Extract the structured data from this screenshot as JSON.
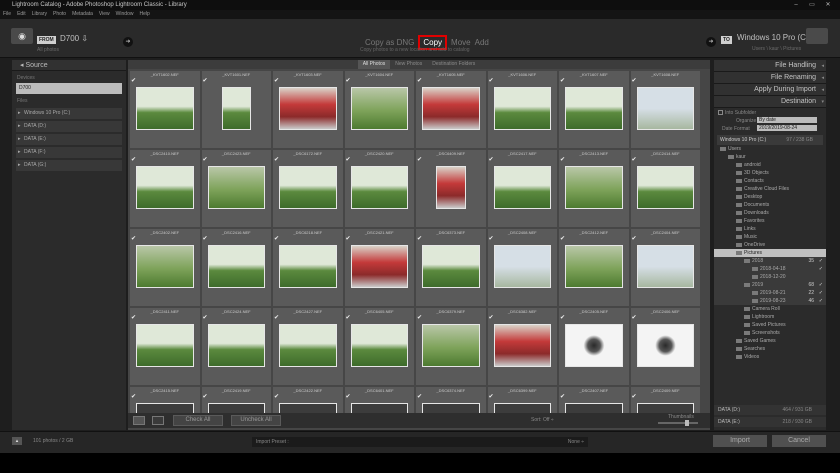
{
  "window": {
    "title": "Lightroom Catalog - Adobe Photoshop Lightroom Classic - Library",
    "controls": [
      "–",
      "▭",
      "✕"
    ]
  },
  "menu": [
    "File",
    "Edit",
    "Library",
    "Photo",
    "Metadata",
    "View",
    "Window",
    "Help"
  ],
  "header": {
    "from_tag": "FROM",
    "source_name": "D700 ⇩",
    "source_sub": "All photos",
    "modes": [
      "Copy as DNG",
      "Copy",
      "Move",
      "Add"
    ],
    "mode_active": "Copy",
    "mode_sub": "Copy photos to a new location and add to catalog",
    "to_tag": "TO",
    "dest_name": "Windows 10 Pro (C:) ⇩",
    "dest_sub": "Users \\ kaur \\ Pictures"
  },
  "source": {
    "title": "◂ Source",
    "devices_label": "Devices",
    "device": "D700",
    "files_label": "Files",
    "drives": [
      "Windows 10 Pro (C:)",
      "DATA (D:)",
      "DATA (E:)",
      "DATA (F:)",
      "DATA (G:)"
    ]
  },
  "tabs": [
    "All Photos",
    "New Photos",
    "Destination Folders"
  ],
  "tab_active": "All Photos",
  "photos": [
    {
      "name": "_KVT1602.NEF",
      "style": "g1"
    },
    {
      "name": "_KVT1601.NEF",
      "style": "g1 portrait"
    },
    {
      "name": "_KVT1603.NEF",
      "style": "red"
    },
    {
      "name": "_KVT1604.NEF",
      "style": "g2"
    },
    {
      "name": "_KVT1605.NEF",
      "style": "red"
    },
    {
      "name": "_KVT1606.NEF",
      "style": "g1"
    },
    {
      "name": "_KVT1607.NEF",
      "style": "g1"
    },
    {
      "name": "_KVT1608.NEF",
      "style": "g3"
    },
    {
      "name": "_DSC2410.NEF",
      "style": "g1"
    },
    {
      "name": "_DSC2423.NEF",
      "style": "g2"
    },
    {
      "name": "_DSC6172.NEF",
      "style": "g1"
    },
    {
      "name": "_DSC2420.NEF",
      "style": "g1"
    },
    {
      "name": "_DSC6409.NEF",
      "style": "red portrait"
    },
    {
      "name": "_DSC2417.NEF",
      "style": "g1"
    },
    {
      "name": "_DSC2413.NEF",
      "style": "g2"
    },
    {
      "name": "_DSC2414.NEF",
      "style": "g1"
    },
    {
      "name": "_DSC2402.NEF",
      "style": "g2"
    },
    {
      "name": "_DSC2416.NEF",
      "style": "g1"
    },
    {
      "name": "_DSC6218.NEF",
      "style": "g1"
    },
    {
      "name": "_DSC2421.NEF",
      "style": "red"
    },
    {
      "name": "_DSC6373.NEF",
      "style": "g1"
    },
    {
      "name": "_DSC2408.NEF",
      "style": "g3"
    },
    {
      "name": "_DSC2412.NEF",
      "style": "g2"
    },
    {
      "name": "_DSC2404.NEF",
      "style": "g3"
    },
    {
      "name": "_DSC2411.NEF",
      "style": "g1"
    },
    {
      "name": "_DSC2424.NEF",
      "style": "g1"
    },
    {
      "name": "_DSC2427.NEF",
      "style": "g1"
    },
    {
      "name": "_DSC6405.NEF",
      "style": "g1"
    },
    {
      "name": "_DSC6379.NEF",
      "style": "g2"
    },
    {
      "name": "_DSC6382.NEF",
      "style": "red"
    },
    {
      "name": "_DSC2405.NEF",
      "style": "bw"
    },
    {
      "name": "_DSC2406.NEF",
      "style": "bw"
    },
    {
      "name": "_DSC2415.NEF",
      "style": "dark"
    },
    {
      "name": "_DSC2419.NEF",
      "style": "dark"
    },
    {
      "name": "_DSC2422.NEF",
      "style": "dark"
    },
    {
      "name": "_DSC6401.NEF",
      "style": "dark"
    },
    {
      "name": "_DSC6374.NEF",
      "style": "dark"
    },
    {
      "name": "_DSC6399.NEF",
      "style": "dark"
    },
    {
      "name": "_DSC2407.NEF",
      "style": "dark"
    },
    {
      "name": "_DSC2409.NEF",
      "style": "dark"
    }
  ],
  "bottom": {
    "check_all": "Check All",
    "uncheck_all": "Uncheck All",
    "sort_label": "Sort:",
    "sort_value": "Off ÷",
    "thumb_label": "Thumbnails",
    "thumb_level": 0.75
  },
  "right": {
    "file_handling": "File Handling",
    "file_renaming": "File Renaming",
    "apply": "Apply During Import",
    "destination": "Destination",
    "into_subfolder": "Into Subfolder",
    "organize_label": "Organize",
    "organize_val": "By date",
    "format_label": "Date Format",
    "format_val": "2019/2019-08-24",
    "volume": "Windows 10 Pro (C:)",
    "volume_cap": "97 / 238 GB",
    "tree": [
      {
        "label": "Users",
        "indent": 0,
        "type": "plain"
      },
      {
        "label": "kaur",
        "indent": 1,
        "type": "plain"
      },
      {
        "label": "android",
        "indent": 2,
        "type": "plain"
      },
      {
        "label": "3D Objects",
        "indent": 2,
        "type": "plain"
      },
      {
        "label": "Contacts",
        "indent": 2,
        "type": "plain"
      },
      {
        "label": "Creative Cloud Files",
        "indent": 2,
        "type": "plain"
      },
      {
        "label": "Desktop",
        "indent": 2,
        "type": "plain"
      },
      {
        "label": "Documents",
        "indent": 2,
        "type": "plain"
      },
      {
        "label": "Downloads",
        "indent": 2,
        "type": "plain"
      },
      {
        "label": "Favorites",
        "indent": 2,
        "type": "plain"
      },
      {
        "label": "Links",
        "indent": 2,
        "type": "plain"
      },
      {
        "label": "Music",
        "indent": 2,
        "type": "plain"
      },
      {
        "label": "OneDrive",
        "indent": 2,
        "type": "plain"
      },
      {
        "label": "Pictures",
        "indent": 2,
        "type": "sel"
      },
      {
        "label": "2018",
        "indent": 3,
        "type": "sub",
        "count": "35",
        "check": "✓"
      },
      {
        "label": "2018-04-18",
        "indent": 4,
        "type": "sub",
        "count": "",
        "check": "✓"
      },
      {
        "label": "2018-12-20",
        "indent": 4,
        "type": "sub",
        "count": "",
        "check": ""
      },
      {
        "label": "2019",
        "indent": 3,
        "type": "sub",
        "count": "68",
        "check": "✓"
      },
      {
        "label": "2019-08-21",
        "indent": 4,
        "type": "sub",
        "count": "22",
        "check": "✓"
      },
      {
        "label": "2019-08-23",
        "indent": 4,
        "type": "sub",
        "count": "46",
        "check": "✓"
      },
      {
        "label": "Camera Roll",
        "indent": 3,
        "type": "plain"
      },
      {
        "label": "Lightroom",
        "indent": 3,
        "type": "plain"
      },
      {
        "label": "Saved Pictures",
        "indent": 3,
        "type": "plain"
      },
      {
        "label": "Screenshots",
        "indent": 3,
        "type": "plain"
      },
      {
        "label": "Saved Games",
        "indent": 2,
        "type": "plain"
      },
      {
        "label": "Searches",
        "indent": 2,
        "type": "plain"
      },
      {
        "label": "Videos",
        "indent": 2,
        "type": "plain"
      }
    ],
    "foot1": "DATA (D:)",
    "foot1_cap": "464 / 931 GB",
    "foot2": "DATA (E:)",
    "foot2_cap": "218 / 930 GB"
  },
  "footer": {
    "count": "101 photos / 2 GB",
    "preset_label": "Import Preset :",
    "preset_val": "None ÷",
    "import": "Import",
    "cancel": "Cancel"
  }
}
